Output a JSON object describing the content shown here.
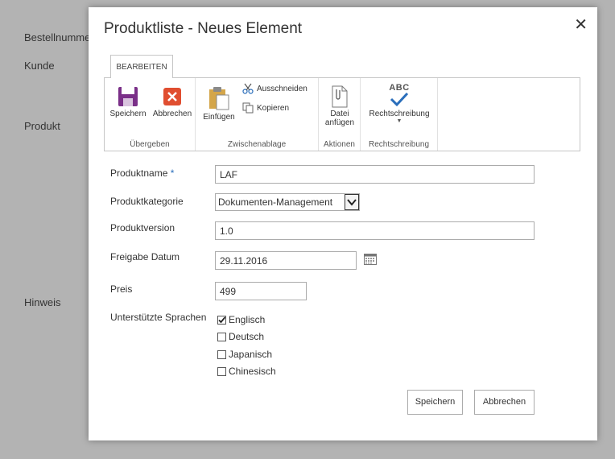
{
  "background": {
    "labels": [
      "Bestellnumme",
      "Kunde",
      "Produkt",
      "Hinweis"
    ]
  },
  "dialog": {
    "title": "Produktliste - Neues Element",
    "close_glyph": "✕"
  },
  "ribbon": {
    "tab_label": "BEARBEITEN",
    "groups": {
      "commit": {
        "label": "Übergeben",
        "save_label": "Speichern",
        "cancel_label": "Abbrechen"
      },
      "clipboard": {
        "label": "Zwischenablage",
        "paste_label": "Einfügen",
        "cut_label": "Ausschneiden",
        "copy_label": "Kopieren"
      },
      "actions": {
        "label": "Aktionen",
        "attach_label_line1": "Datei",
        "attach_label_line2": "anfügen"
      },
      "spelling": {
        "label": "Rechtschreibung",
        "spelling_label": "Rechtschreibung",
        "abc": "ABC"
      }
    }
  },
  "form": {
    "product_name": {
      "label": "Produktname",
      "required_marker": "*",
      "value": "LAF"
    },
    "product_category": {
      "label": "Produktkategorie",
      "value": "Dokumenten-Management"
    },
    "product_version": {
      "label": "Produktversion",
      "value": "1.0"
    },
    "release_date": {
      "label": "Freigabe Datum",
      "value": "29.11.2016"
    },
    "price": {
      "label": "Preis",
      "value": "499"
    },
    "languages": {
      "label": "Unterstützte Sprachen",
      "options": [
        {
          "label": "Englisch",
          "checked": true
        },
        {
          "label": "Deutsch",
          "checked": false
        },
        {
          "label": "Japanisch",
          "checked": false
        },
        {
          "label": "Chinesisch",
          "checked": false
        }
      ]
    }
  },
  "footer": {
    "save_label": "Speichern",
    "cancel_label": "Abbrechen"
  },
  "colors": {
    "save_icon": "#7a2f88",
    "cancel_icon": "#e04e30",
    "accent": "#2a6ebb"
  }
}
